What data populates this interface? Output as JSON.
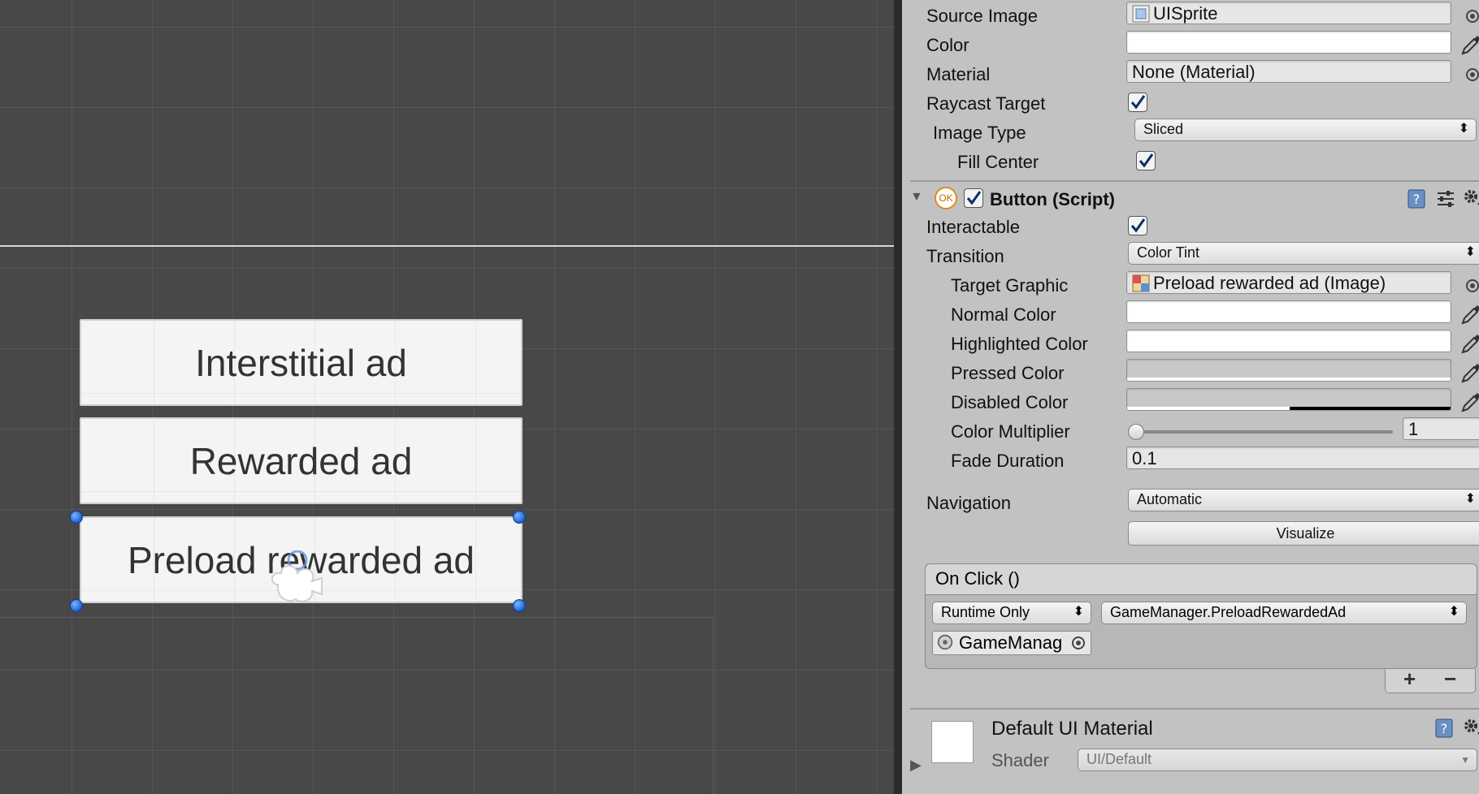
{
  "scene": {
    "buttons": [
      {
        "label": "Interstitial ad"
      },
      {
        "label": "Rewarded ad"
      },
      {
        "label": "Preload rewarded ad"
      }
    ]
  },
  "image_component": {
    "source_image_label": "Source Image",
    "source_image_value": "UISprite",
    "color_label": "Color",
    "material_label": "Material",
    "material_value": "None (Material)",
    "raycast_label": "Raycast Target",
    "raycast_checked": true,
    "image_type_label": "Image Type",
    "image_type_value": "Sliced",
    "fill_center_label": "Fill Center",
    "fill_center_checked": true
  },
  "button_component": {
    "badge": "OK",
    "title": "Button (Script)",
    "interactable_label": "Interactable",
    "transition_label": "Transition",
    "transition_value": "Color Tint",
    "target_graphic_label": "Target Graphic",
    "target_graphic_value": "Preload rewarded ad (Image)",
    "normal_color_label": "Normal Color",
    "highlighted_color_label": "Highlighted Color",
    "pressed_color_label": "Pressed Color",
    "disabled_color_label": "Disabled Color",
    "color_multiplier_label": "Color Multiplier",
    "color_multiplier_value": "1",
    "fade_duration_label": "Fade Duration",
    "fade_duration_value": "0.1",
    "navigation_label": "Navigation",
    "navigation_value": "Automatic",
    "visualize_label": "Visualize"
  },
  "on_click": {
    "title": "On Click ()",
    "runtime_value": "Runtime Only",
    "function_value": "GameManager.PreloadRewardedAd",
    "object_value": "GameManag",
    "add_label": "+",
    "remove_label": "−"
  },
  "material": {
    "name": "Default UI Material",
    "shader_label": "Shader",
    "shader_value": "UI/Default"
  },
  "colors": {
    "scene_bg": "#484848",
    "inspector_bg": "#c2c2c2",
    "handle_blue": "#1a63d6"
  }
}
